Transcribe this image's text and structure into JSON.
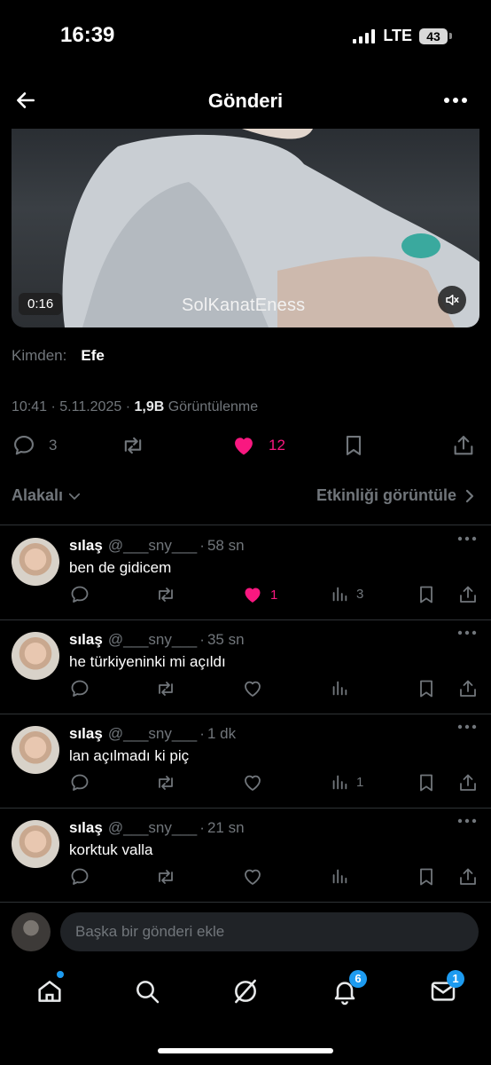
{
  "status_bar": {
    "time": "16:39",
    "network": "LTE",
    "battery": "43"
  },
  "header": {
    "title": "Gönderi"
  },
  "video": {
    "duration": "0:16",
    "watermark": "SolKanatEness"
  },
  "post": {
    "from_label": "Kimden:",
    "from_name": "Efe",
    "timestamp": "10:41 · 5.11.2025 · ",
    "views_count": "1,9B",
    "views_label": " Görüntülenme",
    "reply_count": "3",
    "like_count": "12",
    "liked": true
  },
  "sort": {
    "relevant_label": "Alakalı",
    "activity_label": "Etkinliği görüntüle"
  },
  "replies": [
    {
      "name": "sılaş",
      "handle": "@___sny___",
      "time": "58 sn",
      "text": "ben de gidicem",
      "likes": "1",
      "liked": true,
      "views": "3"
    },
    {
      "name": "sılaş",
      "handle": "@___sny___",
      "time": "35 sn",
      "text": "he türkiyeninki mi açıldı",
      "likes": "",
      "liked": false,
      "views": ""
    },
    {
      "name": "sılaş",
      "handle": "@___sny___",
      "time": "1 dk",
      "text": "lan açılmadı ki piç",
      "likes": "",
      "liked": false,
      "views": "1"
    },
    {
      "name": "sılaş",
      "handle": "@___sny___",
      "time": "21 sn",
      "text": "korktuk valla",
      "likes": "",
      "liked": false,
      "views": ""
    }
  ],
  "compose": {
    "placeholder": "Başka bir gönderi ekle"
  },
  "tabbar": {
    "notifications_badge": "6",
    "messages_badge": "1"
  },
  "colors": {
    "accent": "#1d9bf0",
    "like": "#f91880",
    "muted": "#71767b",
    "background": "#000000"
  },
  "icons": [
    "back-arrow-icon",
    "more-icon",
    "mute-icon",
    "reply-icon",
    "repost-icon",
    "heart-icon",
    "bookmark-icon",
    "share-icon",
    "views-icon",
    "chevron-down-icon",
    "chevron-right-icon",
    "home-icon",
    "search-icon",
    "grok-icon",
    "bell-icon",
    "mail-icon"
  ]
}
